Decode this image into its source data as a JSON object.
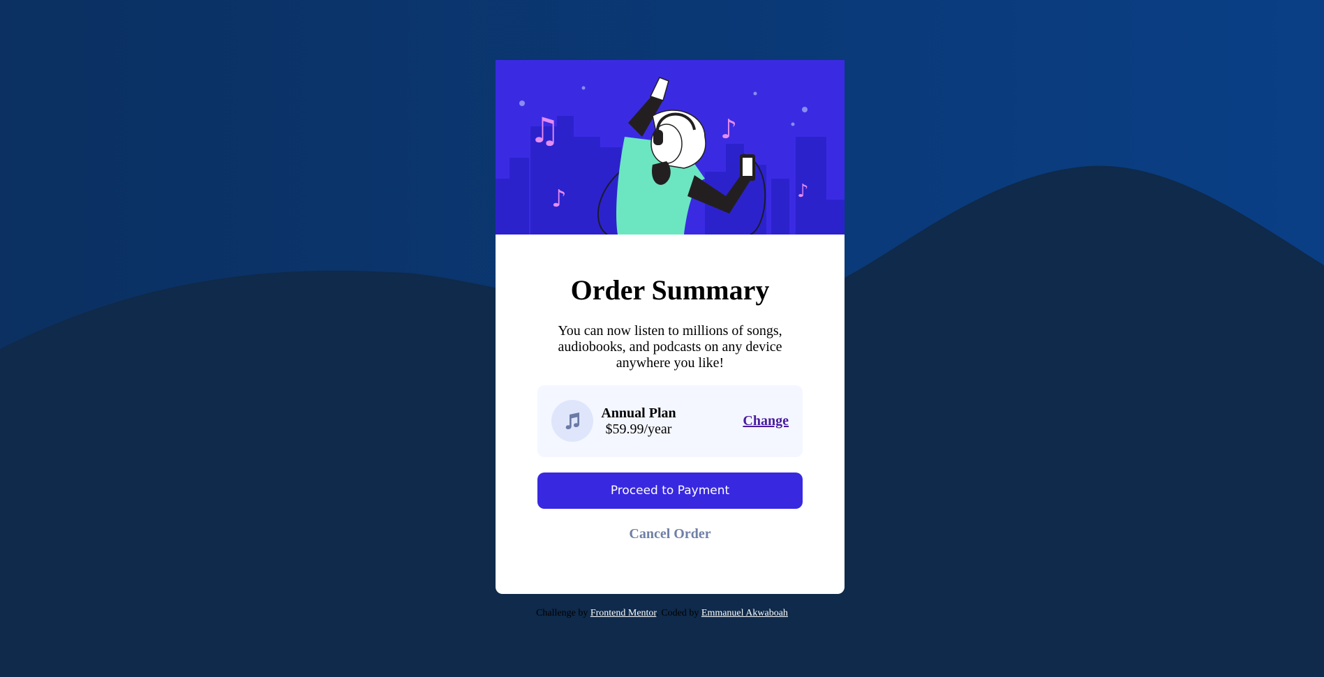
{
  "colors": {
    "background_dark": "#0f2a4a",
    "background_blue": "#0a3a7a",
    "hero_purple": "#3a2be3",
    "accent_button": "#3828e0",
    "change_link": "#4a1ba0",
    "cancel_text": "#6f80a6",
    "plan_panel": "#f4f7ff"
  },
  "card": {
    "hero_icon": "music-listener-illustration",
    "title": "Order Summary",
    "description": "You can now listen to millions of songs, audiobooks, and podcasts on any device anywhere you like!"
  },
  "plan": {
    "icon": "music-note-icon",
    "name": "Annual Plan",
    "price": "$59.99/year",
    "change_label": "Change"
  },
  "actions": {
    "proceed_label": "Proceed to Payment",
    "cancel_label": "Cancel Order"
  },
  "attribution": {
    "challenge_prefix": "Challenge by",
    "challenge_link": "Frontend Mentor",
    "coded_prefix": ". Coded by",
    "coded_link": "Emmanuel Akwaboah"
  }
}
